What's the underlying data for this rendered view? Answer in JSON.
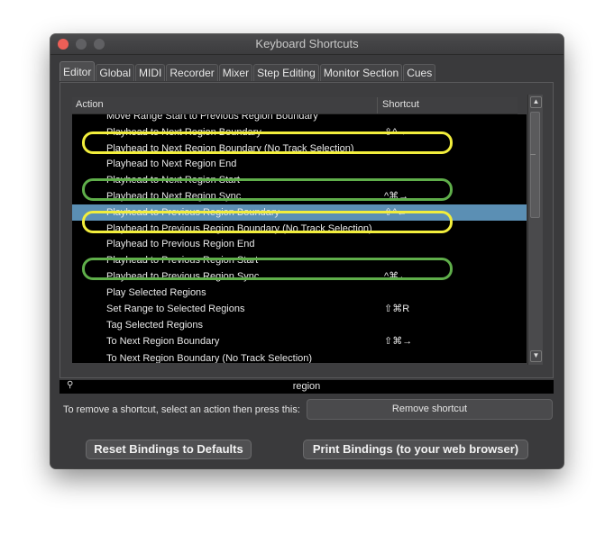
{
  "window": {
    "title": "Keyboard Shortcuts"
  },
  "tabs": [
    "Editor",
    "Global",
    "MIDI",
    "Recorder",
    "Mixer",
    "Step Editing",
    "Monitor Section",
    "Cues"
  ],
  "list": {
    "header_action": "Action",
    "header_shortcut": "Shortcut",
    "rows": [
      {
        "action": "Move Range Start to Previous Region Boundary",
        "shortcut": ""
      },
      {
        "action": "Playhead to Next Region Boundary",
        "shortcut": "⇧^→"
      },
      {
        "action": "Playhead to Next Region Boundary (No Track Selection)",
        "shortcut": ""
      },
      {
        "action": "Playhead to Next Region End",
        "shortcut": ""
      },
      {
        "action": "Playhead to Next Region Start",
        "shortcut": ""
      },
      {
        "action": "Playhead to Next Region Sync",
        "shortcut": "^⌘→"
      },
      {
        "action": "Playhead to Previous Region Boundary",
        "shortcut": "⇧^←"
      },
      {
        "action": "Playhead to Previous Region Boundary (No Track Selection)",
        "shortcut": ""
      },
      {
        "action": "Playhead to Previous Region End",
        "shortcut": ""
      },
      {
        "action": "Playhead to Previous Region Start",
        "shortcut": ""
      },
      {
        "action": "Playhead to Previous Region Sync",
        "shortcut": "^⌘←"
      },
      {
        "action": "Play Selected Regions",
        "shortcut": ""
      },
      {
        "action": "Set Range to Selected Regions",
        "shortcut": "⇧⌘R"
      },
      {
        "action": "Tag Selected Regions",
        "shortcut": ""
      },
      {
        "action": "To Next Region Boundary",
        "shortcut": "⇧⌘→"
      },
      {
        "action": "To Next Region Boundary (No Track Selection)",
        "shortcut": ""
      }
    ]
  },
  "search": {
    "value": "region"
  },
  "hint": "To remove a shortcut, select an action then press this:",
  "buttons": {
    "remove": "Remove shortcut",
    "reset": "Reset Bindings to Defaults",
    "print": "Print Bindings (to your web browser)"
  },
  "colors": {
    "selection": "#5b8fb4",
    "highlight_yellow": "#f2ee3c",
    "highlight_green": "#5fae4a"
  }
}
